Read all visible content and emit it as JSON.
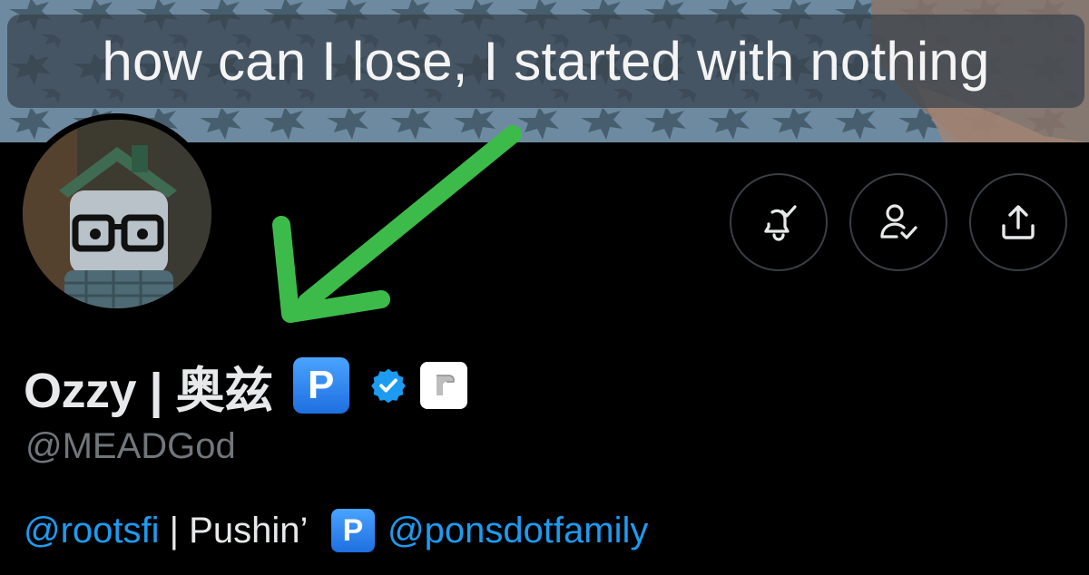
{
  "banner": {
    "caption": "how can I lose, I started with nothing"
  },
  "profile": {
    "display_name": "Ozzy | 奥兹",
    "badge_letter": "P",
    "handle": "@MEADGod",
    "verified_color": "#1d9bf0"
  },
  "bio": {
    "mention_1": "@rootsfi",
    "text_1": " | Pushin’ ",
    "badge_letter": "P",
    "mention_2": "@ponsdotfamily"
  },
  "actions": {
    "notifications_icon": "bell-check-icon",
    "follow_icon": "person-check-icon",
    "share_icon": "share-icon"
  },
  "annotation": {
    "arrow_color": "#3dbb4a"
  }
}
